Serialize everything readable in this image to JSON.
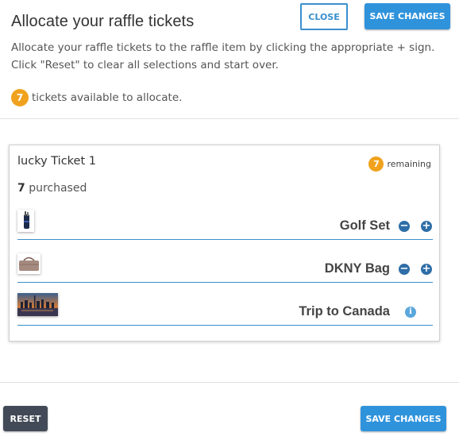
{
  "header": {
    "title": "Allocate your raffle tickets",
    "close_label": "CLOSE",
    "save_label": "SAVE CHANGES"
  },
  "description": "Allocate your raffle tickets to the raffle item by clicking the appropriate + sign. Click \"Reset\" to clear all selections and start over.",
  "available": {
    "count": "7",
    "text": "tickets available to allocate."
  },
  "ticket": {
    "name": "lucky Ticket 1",
    "remaining_count": "7",
    "remaining_label": "remaining",
    "purchased_count": "7",
    "purchased_label": "purchased"
  },
  "items": [
    {
      "name": "Golf Set",
      "controls": [
        "minus-icon",
        "plus-icon"
      ]
    },
    {
      "name": "DKNY Bag",
      "controls": [
        "minus-icon",
        "plus-icon"
      ]
    },
    {
      "name": "Trip to Canada",
      "controls": [
        "info-icon"
      ]
    }
  ],
  "footer": {
    "reset_label": "RESET",
    "save_label": "SAVE CHANGES"
  },
  "colors": {
    "accent": "#2f93dc",
    "badge": "#f0a21e",
    "reset": "#434a57"
  }
}
